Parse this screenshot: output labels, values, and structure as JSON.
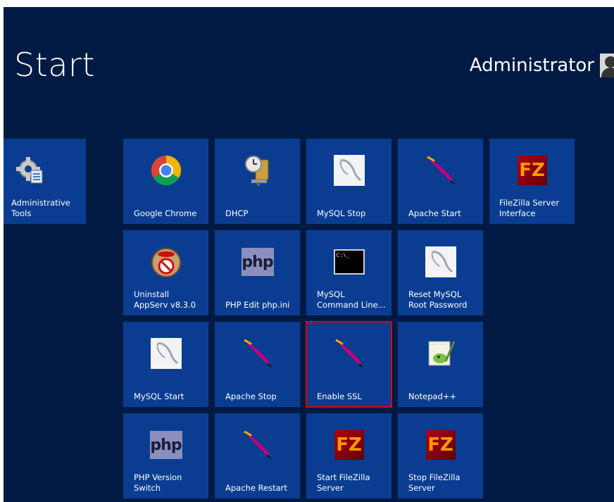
{
  "header": {
    "title": "Start",
    "user_name": "Administrator"
  },
  "colors": {
    "background": "#001a44",
    "tile": "#0a3d91",
    "selected_outline": "#e60000"
  },
  "tiles": [
    {
      "label": "Administrative Tools",
      "icon": "admin-tools-gear-icon"
    },
    {
      "label": "Google Chrome",
      "icon": "chrome-icon"
    },
    {
      "label": "DHCP",
      "icon": "dhcp-clock-icon"
    },
    {
      "label": "MySQL Stop",
      "icon": "mysql-dolphin-icon"
    },
    {
      "label": "Apache Start",
      "icon": "apache-feather-icon"
    },
    {
      "label": "FileZilla Server Interface",
      "icon": "filezilla-icon"
    },
    {
      "label": "Uninstall AppServ v8.3.0",
      "icon": "nsis-uninstall-icon"
    },
    {
      "label": "PHP Edit php.ini",
      "icon": "php-icon",
      "icon_text": "php"
    },
    {
      "label": "MySQL Command Line...",
      "icon": "command-prompt-icon",
      "icon_text": "C:\\_"
    },
    {
      "label": "Reset MySQL Root Password",
      "icon": "mysql-dolphin-icon"
    },
    {
      "label": "MySQL Start",
      "icon": "mysql-dolphin-icon"
    },
    {
      "label": "Apache Stop",
      "icon": "apache-feather-icon"
    },
    {
      "label": "Enable SSL",
      "icon": "apache-feather-icon",
      "selected": true
    },
    {
      "label": "Notepad++",
      "icon": "notepad-plus-plus-icon"
    },
    {
      "label": "PHP Version Switch",
      "icon": "php-icon",
      "icon_text": "php"
    },
    {
      "label": "Apache Restart",
      "icon": "apache-feather-icon"
    },
    {
      "label": "Start FileZilla Server",
      "icon": "filezilla-icon"
    },
    {
      "label": "Stop FileZilla Server",
      "icon": "filezilla-icon"
    }
  ]
}
